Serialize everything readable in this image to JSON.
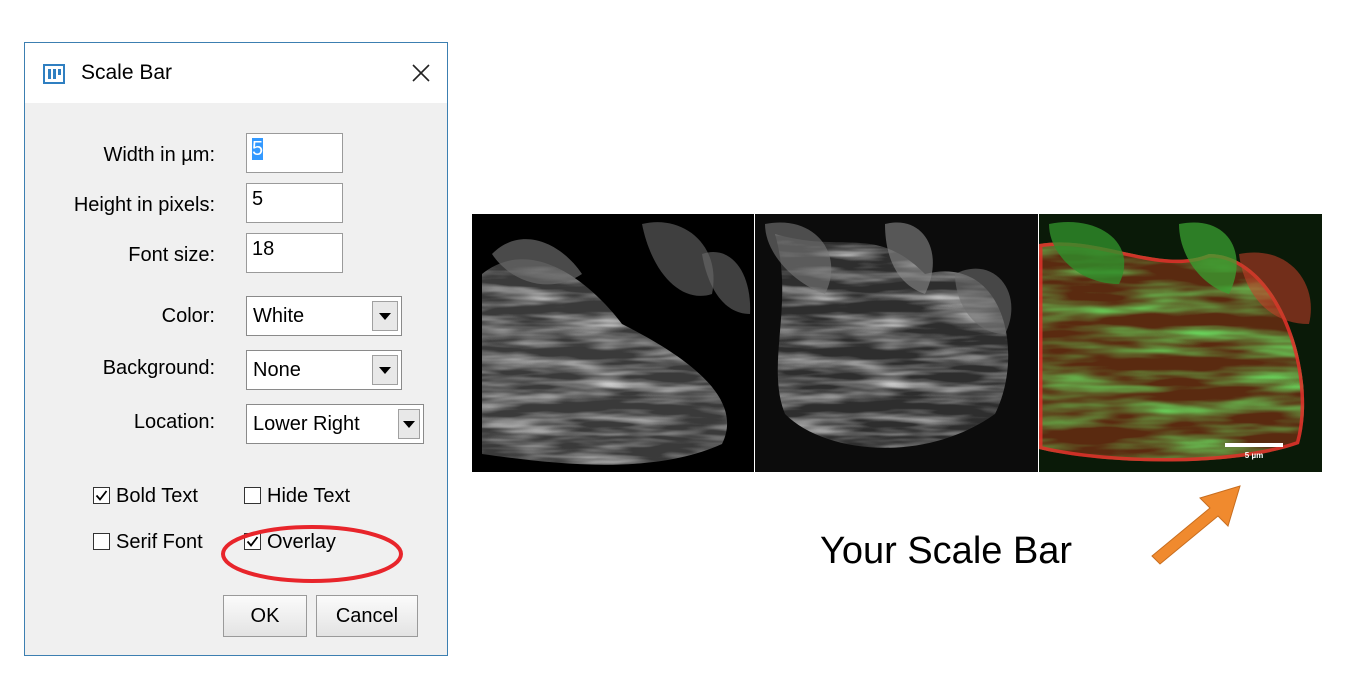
{
  "dialog": {
    "title": "Scale Bar",
    "fields": {
      "width_label": "Width in µm:",
      "width_value": "5",
      "height_label": "Height in pixels:",
      "height_value": "5",
      "font_label": "Font size:",
      "font_value": "18"
    },
    "selects": {
      "color_label": "Color:",
      "color_value": "White",
      "background_label": "Background:",
      "background_value": "None",
      "location_label": "Location:",
      "location_value": "Lower Right"
    },
    "checkboxes": {
      "bold_label": "Bold Text",
      "bold_checked": true,
      "hide_label": "Hide Text",
      "hide_checked": false,
      "serif_label": "Serif Font",
      "serif_checked": false,
      "overlay_label": "Overlay",
      "overlay_checked": true
    },
    "buttons": {
      "ok": "OK",
      "cancel": "Cancel"
    }
  },
  "figure": {
    "scale_bar_label": "5 µm",
    "caption": "Your Scale Bar"
  },
  "colors": {
    "highlight": "#e8252b",
    "arrow": "#f08a2e",
    "dialog_border": "#3c7fb1",
    "selection": "#3399ff"
  }
}
